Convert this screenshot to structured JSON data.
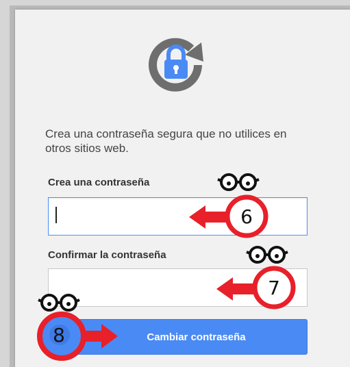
{
  "intro_text": "Crea una contraseña segura que no utilices en otros sitios web.",
  "password_field": {
    "label": "Crea una contraseña",
    "value": ""
  },
  "confirm_field": {
    "label": "Confirmar la contraseña",
    "value": ""
  },
  "submit_label": "Cambiar contraseña",
  "annotations": [
    {
      "step": "6",
      "icon": "eyeglasses-icon"
    },
    {
      "step": "7",
      "icon": "eyeglasses-icon"
    },
    {
      "step": "8",
      "icon": "eyeglasses-icon"
    }
  ],
  "colors": {
    "accent": "#4a8af4",
    "annotation_red": "#e8202a",
    "lock_blue": "#4a8af4",
    "lock_ring": "#6e6e6e"
  },
  "icons": {
    "logo": "lock-refresh-icon",
    "arrow": "arrow-left-icon"
  }
}
